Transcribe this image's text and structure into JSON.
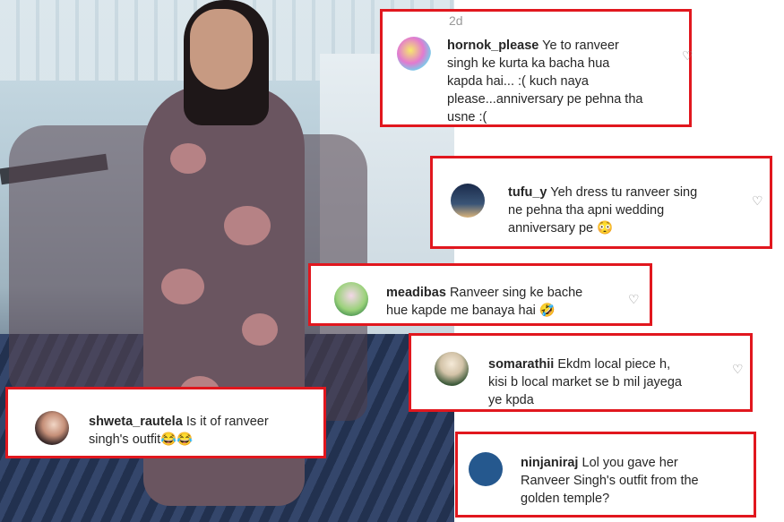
{
  "post": {
    "timestamp": "2d"
  },
  "comments": [
    {
      "username": "hornok_please",
      "text": "Ye to ranveer singh ke kurta ka bacha hua kapda hai... :( kuch naya please...anniversary pe pehna tha usne :(",
      "lines": [
        "Ye to ranveer",
        "singh ke kurta ka bacha hua",
        "kapda hai... :( kuch naya",
        "please...anniversary pe pehna tha",
        "usne :("
      ]
    },
    {
      "username": "tufu_y",
      "text": "Yeh dress tu ranveer sing ne pehna tha apni wedding anniversary pe 😳",
      "lines": [
        "Yeh dress tu ranveer sing",
        "ne pehna tha apni wedding",
        "anniversary pe 😳"
      ]
    },
    {
      "username": "meadibas",
      "text": "Ranveer sing ke bache hue kapde me banaya hai 🤣",
      "lines": [
        "Ranveer sing ke bache",
        "hue kapde me banaya hai 🤣"
      ]
    },
    {
      "username": "somarathii",
      "text": "Ekdm local piece h, kisi b local market se b mil jayega ye kpda",
      "lines": [
        "Ekdm local piece h,",
        "kisi b local market se b mil jayega",
        "ye kpda"
      ]
    },
    {
      "username": "shweta_rautela",
      "text": "Is it of ranveer singh's outfit😂😂",
      "lines": [
        "Is it of ranveer",
        "singh's outfit😂😂"
      ]
    },
    {
      "username": "ninjaniraj",
      "text": "Lol you gave her Ranveer Singh's outfit from the golden temple?",
      "lines": [
        "Lol you gave her",
        "Ranveer Singh's outfit from the",
        "golden temple?"
      ]
    }
  ],
  "colors": {
    "highlight_border": "#e1171e",
    "text": "#262626",
    "muted": "#8e8e8e"
  },
  "icons": {
    "like": "heart-outline-icon"
  }
}
